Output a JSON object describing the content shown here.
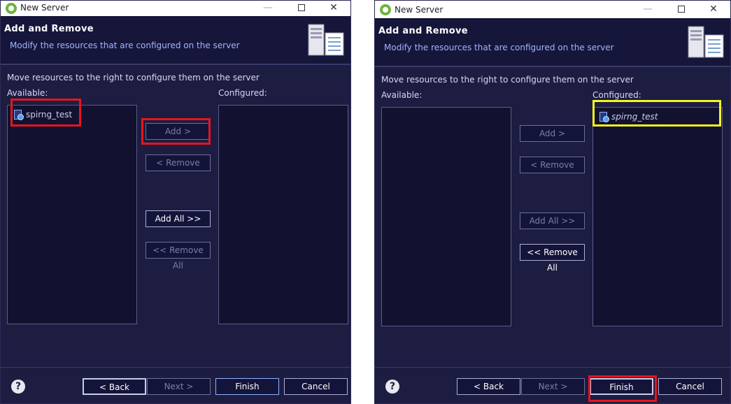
{
  "window_title": "New Server",
  "titlebar": {
    "minimize_glyph": "—",
    "maximize_glyph": "",
    "close_glyph": "✕"
  },
  "header": {
    "title": "Add and Remove",
    "subtitle": "Modify the resources that are configured on the server",
    "icon": "server-icon"
  },
  "instruction": "Move resources to the right to configure them on the server",
  "available_label": "Available:",
  "configured_label": "Configured:",
  "project_name": "spirng_test",
  "buttons": {
    "add": "Add >",
    "remove": "< Remove",
    "add_all": "Add All >>",
    "remove_all": "<< Remove All"
  },
  "footer": {
    "help": "?",
    "back": "< Back",
    "next": "Next >",
    "finish": "Finish",
    "cancel": "Cancel"
  },
  "highlight_colors": {
    "red": "#e8141c",
    "yellow": "#f5f51e"
  },
  "panels": [
    {
      "state": "before",
      "available_items": [
        "spirng_test"
      ],
      "configured_items": []
    },
    {
      "state": "after",
      "available_items": [],
      "configured_items": [
        "spirng_test"
      ]
    }
  ]
}
